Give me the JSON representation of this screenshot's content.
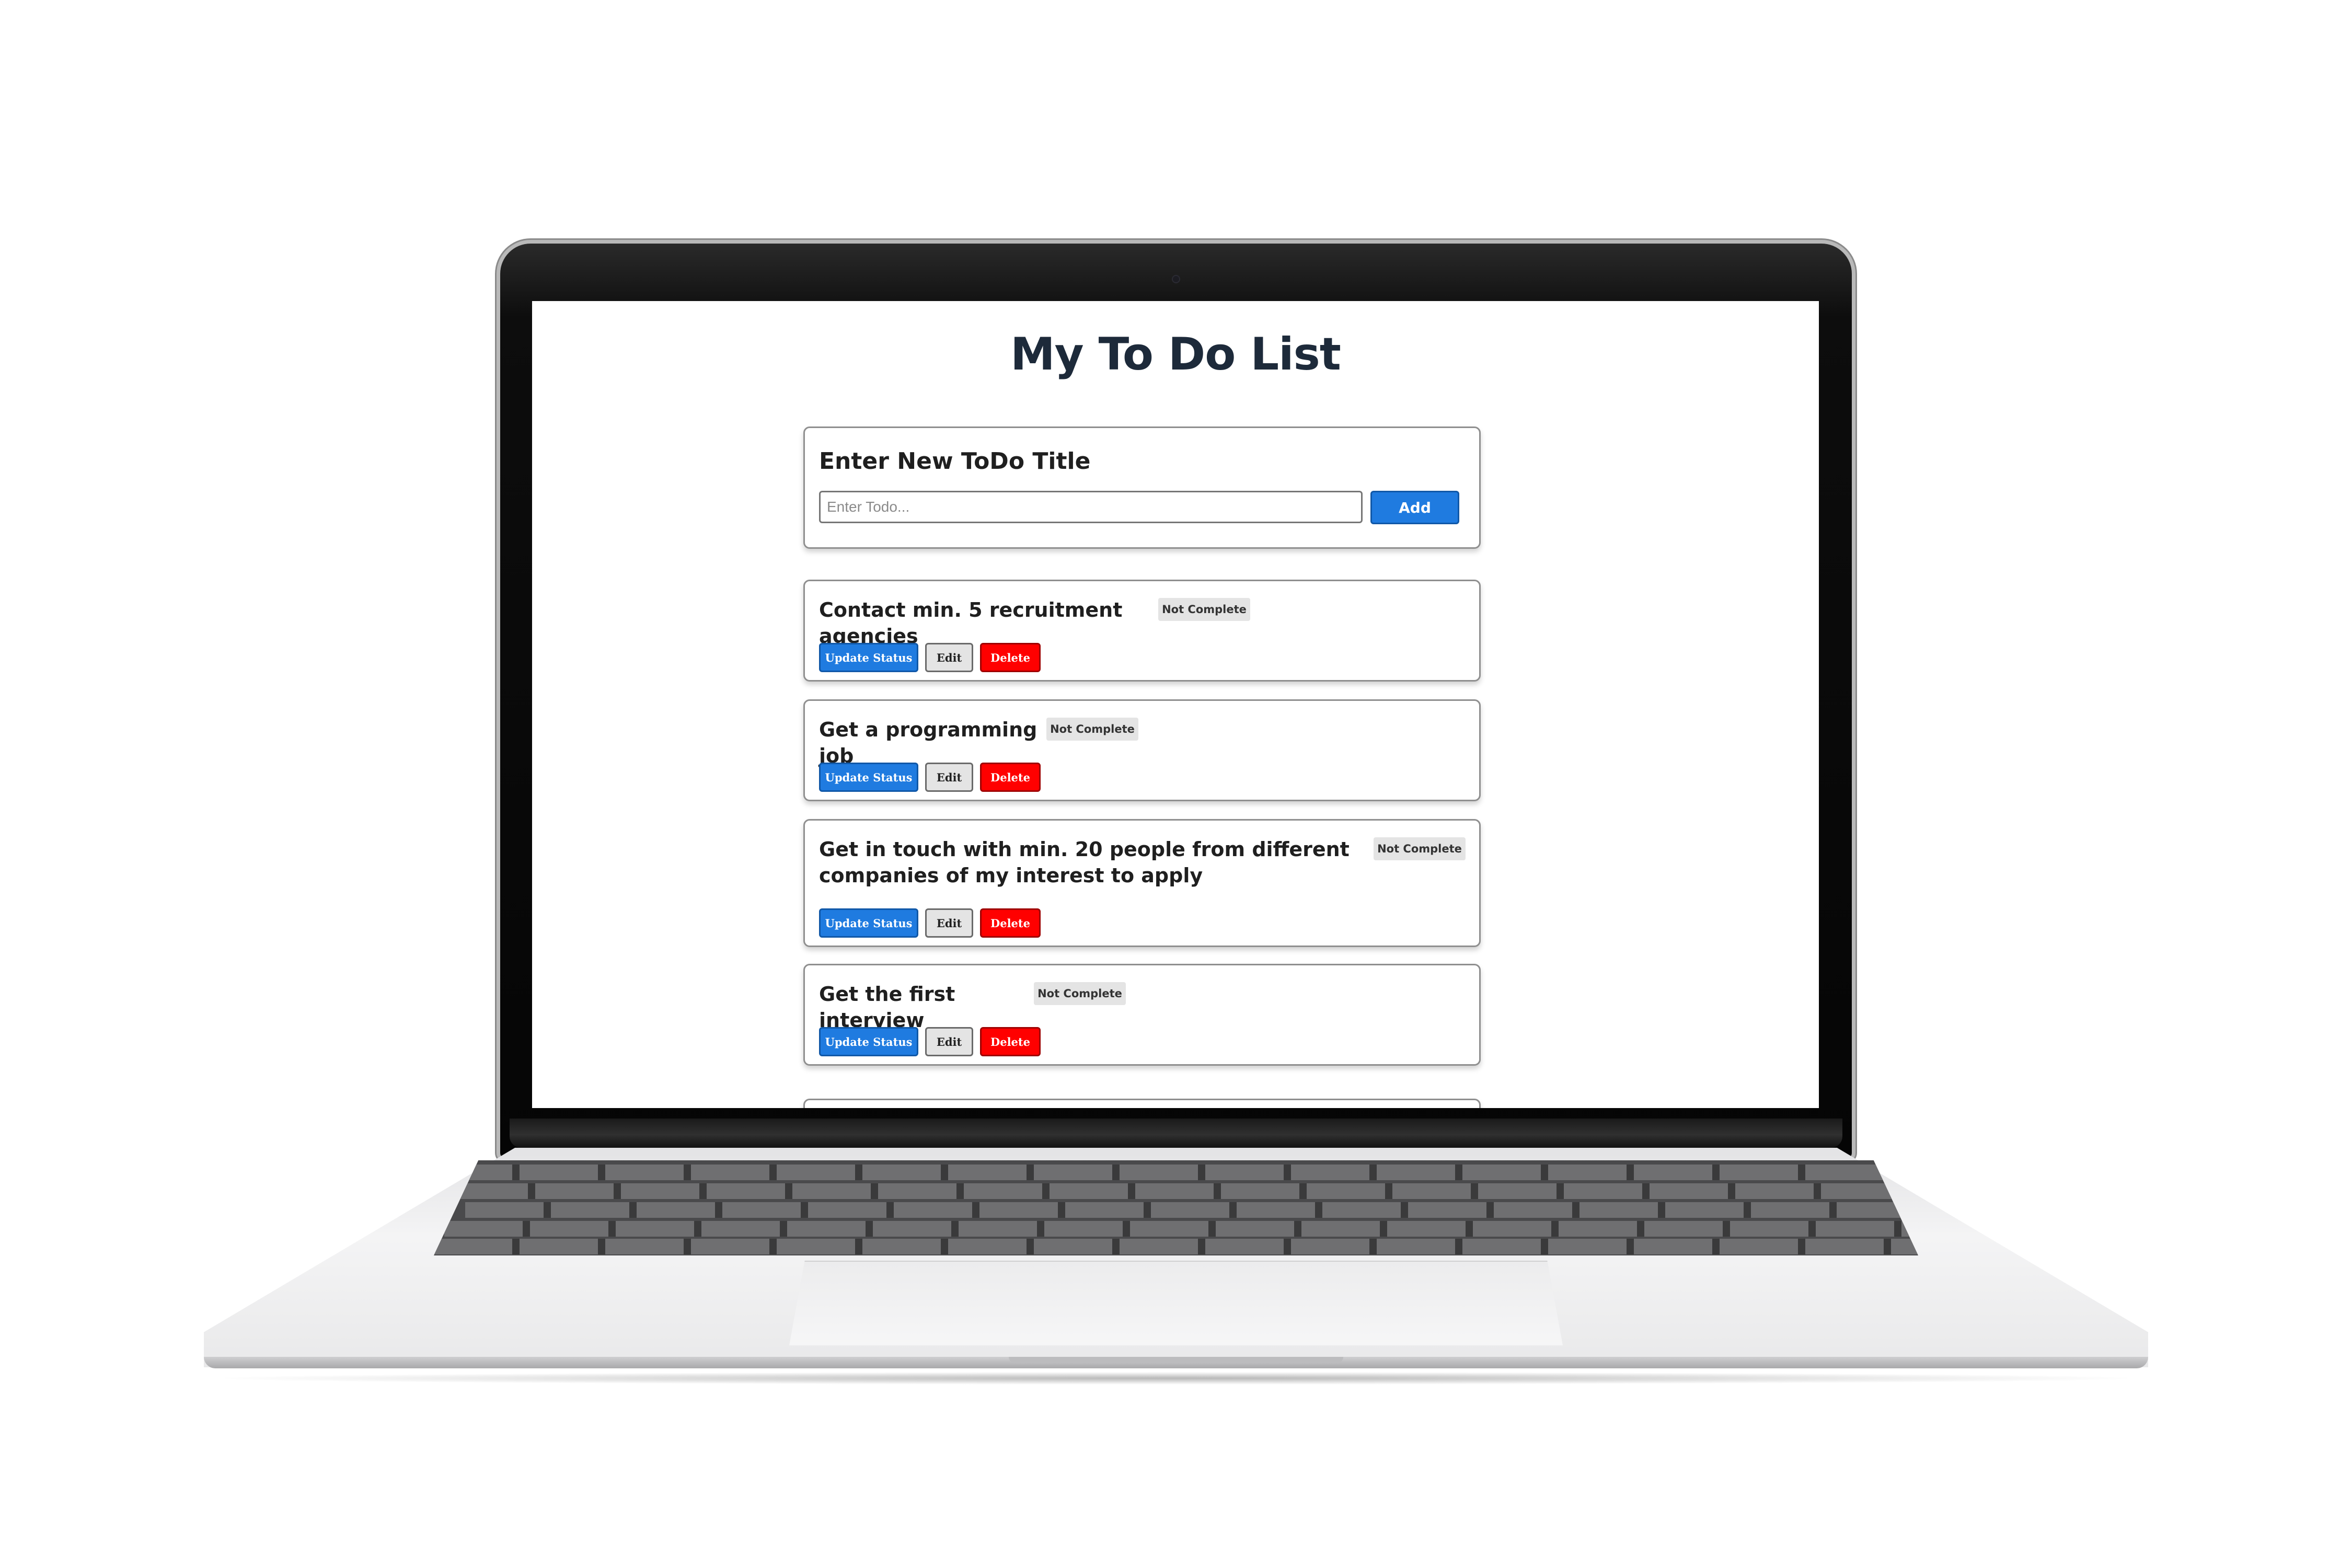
{
  "app": {
    "title": "My To Do List"
  },
  "new_todo": {
    "heading": "Enter New ToDo Title",
    "input_value": "",
    "input_placeholder": "Enter Todo...",
    "add_label": "Add"
  },
  "todos": [
    {
      "title": "Contact min. 5 recruitment agencies",
      "status": "Not Complete",
      "update_label": "Update Status",
      "edit_label": "Edit",
      "delete_label": "Delete"
    },
    {
      "title": "Get a programming job",
      "status": "Not Complete",
      "update_label": "Update Status",
      "edit_label": "Edit",
      "delete_label": "Delete"
    },
    {
      "title": "Get in touch with min. 20 people from different companies of my interest to apply",
      "status": "Not Complete",
      "update_label": "Update Status",
      "edit_label": "Edit",
      "delete_label": "Delete"
    },
    {
      "title": "Get the first interview",
      "status": "Not Complete",
      "update_label": "Update Status",
      "edit_label": "Edit",
      "delete_label": "Delete"
    }
  ],
  "colors": {
    "primary_button": "#1f7be0",
    "delete_button": "#ff0000",
    "badge_background": "#e4e4e4",
    "title_text": "#1d2a3a"
  }
}
